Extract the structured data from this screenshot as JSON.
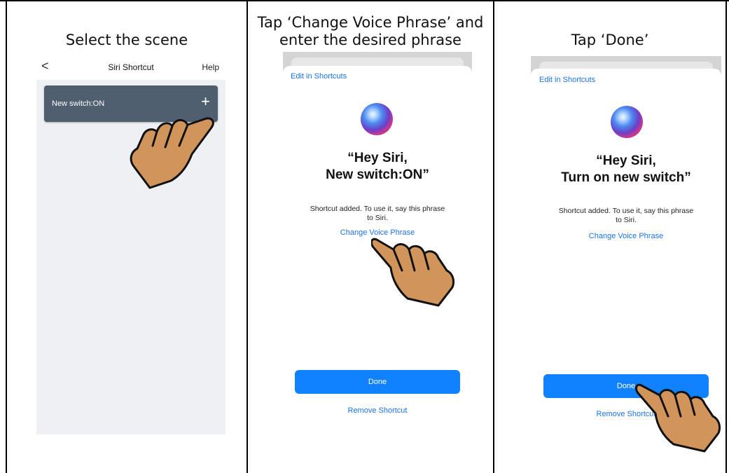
{
  "steps": [
    {
      "caption_lines": [
        "Select the scene"
      ],
      "screen": {
        "back_glyph": "<",
        "title": "Siri Shortcut",
        "help_label": "Help",
        "scene_name": "New switch:ON",
        "add_glyph": "+"
      }
    },
    {
      "caption_lines": [
        "Tap ‘Change Voice Phrase’ and",
        "enter the desired phrase"
      ],
      "sheet": {
        "edit_link": "Edit in Shortcuts",
        "phrase_line1": "“Hey Siri,",
        "phrase_line2": "New switch:ON”",
        "info_line1": "Shortcut added. To use it, say this phrase",
        "info_line2": "to Siri.",
        "change_link": "Change Voice Phrase",
        "done_label": "Done",
        "remove_label": "Remove Shortcut"
      }
    },
    {
      "caption_lines": [
        "Tap ‘Done’"
      ],
      "sheet": {
        "edit_link": "Edit in Shortcuts",
        "phrase_line1": "“Hey Siri,",
        "phrase_line2": "Turn on new switch”",
        "info_line1": "Shortcut added. To use it, say this phrase",
        "info_line2": "to Siri.",
        "change_link": "Change Voice Phrase",
        "done_label": "Done",
        "remove_label": "Remove Shortcut"
      }
    }
  ],
  "icons": {
    "pointer": "pointing-hand-icon",
    "siri": "siri-orb-icon"
  },
  "colors": {
    "scene_card": "#505f70",
    "link_blue": "#1a73e8",
    "done_button": "#1082ff",
    "hand_fill": "#d1955c"
  }
}
